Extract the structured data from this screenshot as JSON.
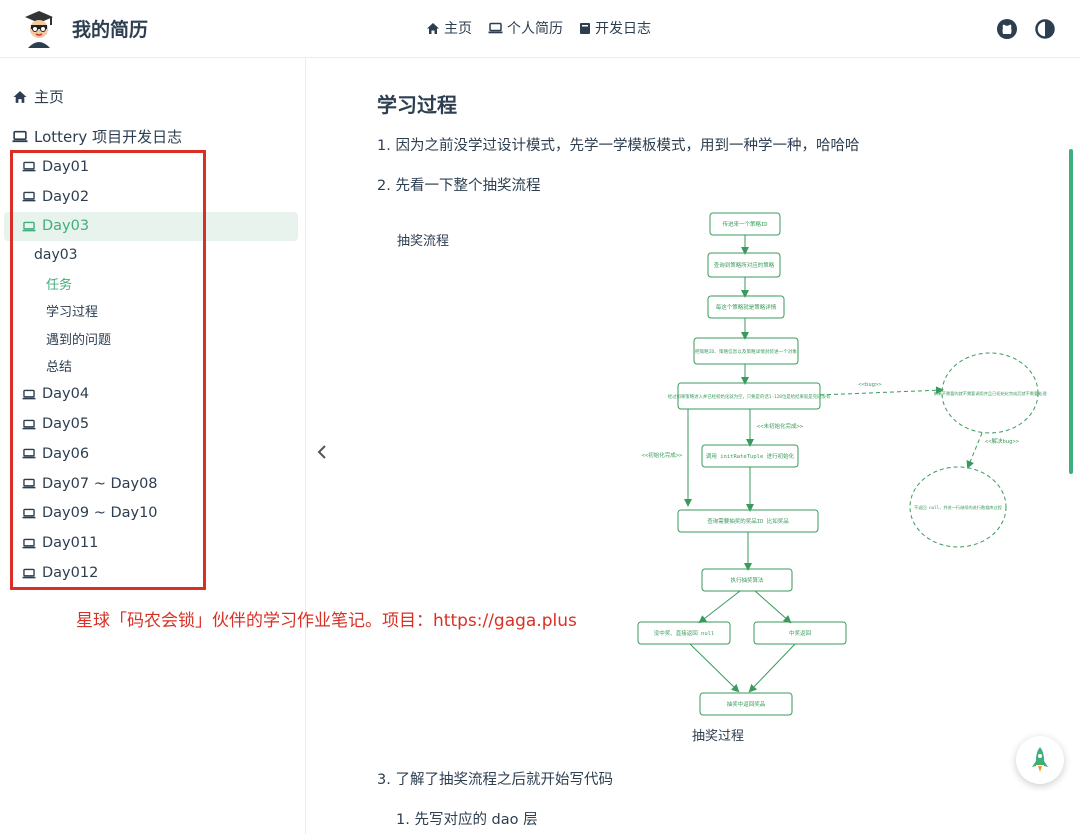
{
  "navbar": {
    "title": "我的简历",
    "links": [
      {
        "icon": "home-icon",
        "label": "主页"
      },
      {
        "icon": "laptop-icon",
        "label": "个人简历"
      },
      {
        "icon": "book-icon",
        "label": "开发日志"
      }
    ]
  },
  "sidebar": {
    "home": "主页",
    "group": "Lottery 项目开发日志",
    "items": [
      {
        "label": "Day01"
      },
      {
        "label": "Day02"
      },
      {
        "label": "Day03",
        "active": true
      },
      {
        "label": "Day04"
      },
      {
        "label": "Day05"
      },
      {
        "label": "Day06"
      },
      {
        "label": "Day07 ~ Day08"
      },
      {
        "label": "Day09 ~ Day10"
      },
      {
        "label": "Day011"
      },
      {
        "label": "Day012"
      }
    ],
    "sub": "day03",
    "subsub": [
      "任务",
      "学习过程",
      "遇到的问题",
      "总结"
    ]
  },
  "content": {
    "heading": "学习过程",
    "p1": "1. 因为之前没学过设计模式，先学一学模板模式，用到一种学一种，哈哈哈",
    "p2": "2. 先看一下整个抽奖流程",
    "diagram_label": "抽奖流程",
    "diagram_caption": "抽奖过程",
    "p3": "3. 了解了抽奖流程之后就开始写代码",
    "p4": "1. 先写对应的 dao 层"
  },
  "watermark": "星球「码农会锁」伙伴的学习作业笔记。项目：https://gaga.plus",
  "flow": {
    "n1": "传进来一个策略ID",
    "n2": "查询到策略所对应的策略",
    "n3": "每这个策略就是策略详情",
    "n4": "把策略ID、策略信息以及策略详情封装进一个对象",
    "n5": "经过如果策略进入并已经初始化就为空，只要是的话1-128位是给结果就是完成没有",
    "n6": "调用 initRateTuple 进行初始化",
    "n7": "查询需要抽奖的奖品ID 比如奖品",
    "n8": "执行抽奖算法",
    "n9": "没中奖、直接返回 null",
    "n10": "中奖返回",
    "n11": "抽奖中返回奖品",
    "side1": "如果不需要的就不需要调用并且已初始化完成后就不需要处理",
    "side2": "不返回 null，并进一行继续的进行数据库过程",
    "l1": "<<bug>>",
    "l2": "<<未初始化完成>>",
    "l3": "<<初始化完成>>",
    "l4": "<<解决bug>>"
  }
}
